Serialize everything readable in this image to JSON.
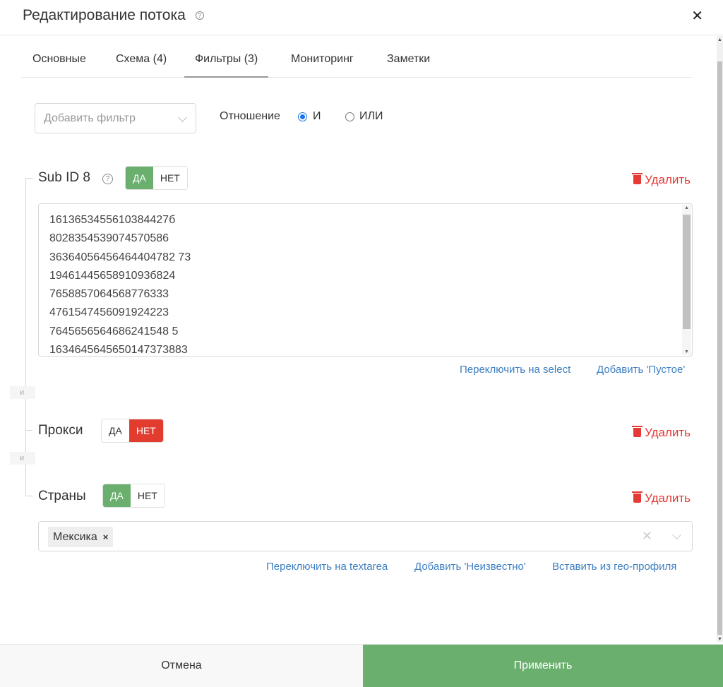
{
  "header": {
    "title": "Редактирование потока",
    "help_glyph": "?",
    "close_glyph": "✕"
  },
  "tabs": [
    {
      "label": "Основные",
      "active": false
    },
    {
      "label": "Схема (4)",
      "active": false
    },
    {
      "label": "Фильтры (3)",
      "active": true
    },
    {
      "label": "Мониторинг",
      "active": false
    },
    {
      "label": "Заметки",
      "active": false
    }
  ],
  "toolbar": {
    "add_filter_placeholder": "Добавить фильтр",
    "relation_label": "Отношение",
    "relation_options": [
      {
        "label": "И",
        "checked": true
      },
      {
        "label": "ИЛИ",
        "checked": false
      }
    ]
  },
  "connector_label": "и",
  "filters": [
    {
      "title": "Sub ID 8",
      "has_help": true,
      "toggle": {
        "yes": "ДА",
        "no": "НЕТ",
        "selected": "yes"
      },
      "delete_label": "Удалить",
      "values": [
        "1613653455610384427б",
        "8028354539074570586",
        "36364056456464404782 73",
        "1946144565891093б824",
        "7658857064568776333",
        "4761547456091924223",
        "7645656564686241548 5",
        "1634645645650147373883"
      ],
      "links": [
        "Переключить на select",
        "Добавить 'Пустое'"
      ]
    },
    {
      "title": "Прокси",
      "toggle": {
        "yes": "ДА",
        "no": "НЕТ",
        "selected": "no"
      },
      "delete_label": "Удалить"
    },
    {
      "title": "Страны",
      "toggle": {
        "yes": "ДА",
        "no": "НЕТ",
        "selected": "yes"
      },
      "delete_label": "Удалить",
      "chips": [
        "Мексика"
      ],
      "chip_remove_glyph": "×",
      "clear_glyph": "✕",
      "links": [
        "Переключить на textarea",
        "Добавить 'Неизвестно'",
        "Вставить из гео-профиля"
      ]
    }
  ],
  "footer": {
    "cancel_label": "Отмена",
    "apply_label": "Применить"
  },
  "colors": {
    "green": "#6aaf6e",
    "red": "#e23c2f",
    "link": "#3d7fc2",
    "delete": "#e53935"
  }
}
